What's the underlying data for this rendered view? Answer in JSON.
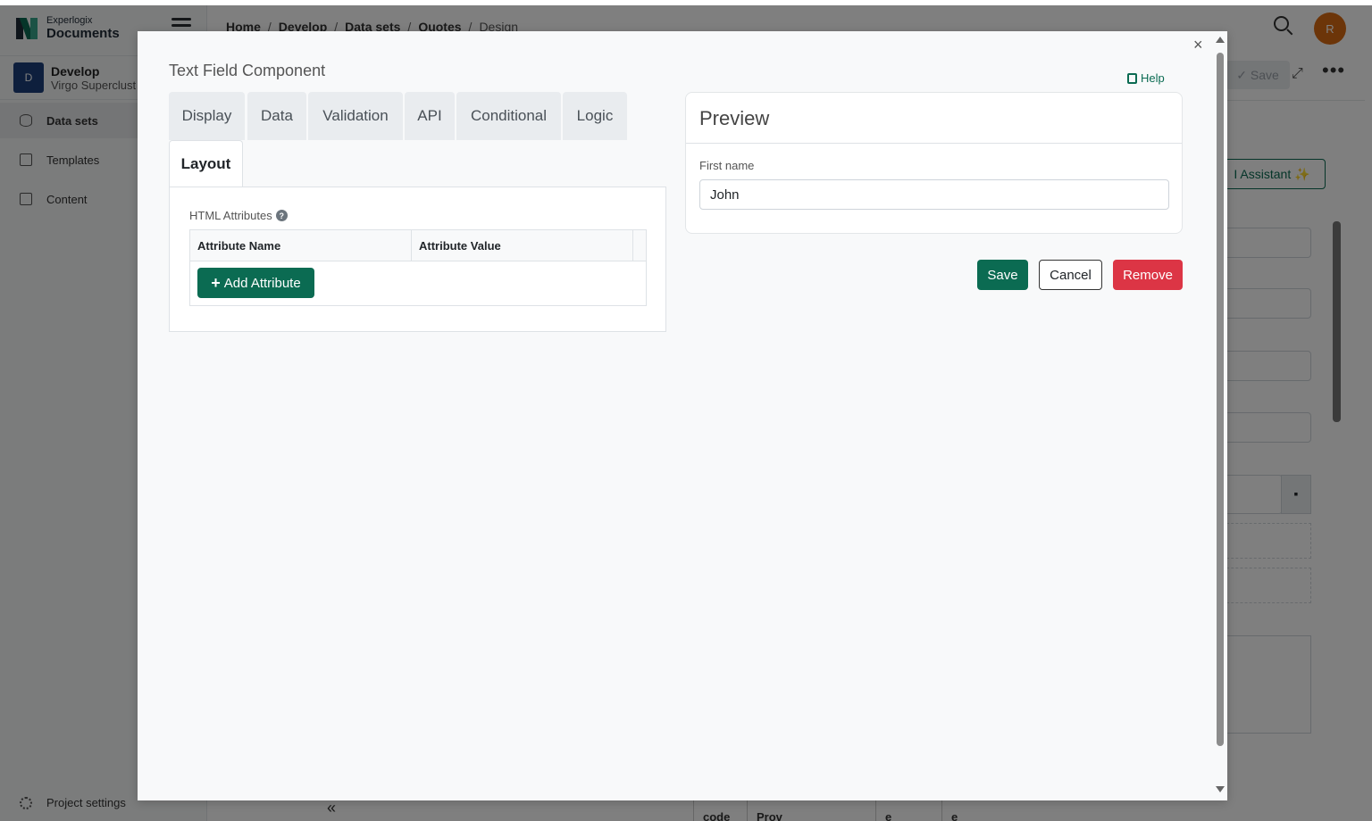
{
  "app": {
    "logo_small": "Experlogix",
    "logo_big": "Documents",
    "project": {
      "avatar": "D",
      "name": "Develop",
      "subtitle": "Virgo Superclust"
    },
    "nav": [
      {
        "label": "Data sets",
        "icon": "database-icon",
        "active": true
      },
      {
        "label": "Templates",
        "icon": "template-icon",
        "active": false
      },
      {
        "label": "Content",
        "icon": "content-icon",
        "active": false
      }
    ],
    "project_settings": "Project settings",
    "collapse_glyph": "«",
    "breadcrumb": [
      "Home",
      "Develop",
      "Data sets",
      "Quotes",
      "Design"
    ],
    "user_initial": "R",
    "bg_save": "✓ Save",
    "bg_expand": "⤢",
    "bg_more": "•••",
    "bg_assistant": "I Assistant ✨",
    "bg_cal": "▪",
    "bg_bottom_cells": [
      "code",
      "Prov",
      "e",
      "e"
    ]
  },
  "modal": {
    "close_glyph": "×",
    "title": "Text Field Component",
    "help": "Help",
    "tabs": [
      {
        "label": "Display"
      },
      {
        "label": "Data"
      },
      {
        "label": "Validation"
      },
      {
        "label": "API"
      },
      {
        "label": "Conditional"
      },
      {
        "label": "Logic"
      },
      {
        "label": "Layout",
        "active": true
      }
    ],
    "html_attributes_label": "HTML Attributes",
    "help_glyph": "?",
    "columns": [
      "Attribute Name",
      "Attribute Value"
    ],
    "add_attribute": "Add Attribute",
    "add_glyph": "+",
    "preview": {
      "title": "Preview",
      "field_label": "First name",
      "field_value": "John"
    },
    "buttons": {
      "save": "Save",
      "cancel": "Cancel",
      "remove": "Remove"
    }
  },
  "colors": {
    "primary": "#0b6b52",
    "danger": "#dc3545",
    "avatar_user": "#d96a12",
    "avatar_project": "#1c3f7a"
  }
}
